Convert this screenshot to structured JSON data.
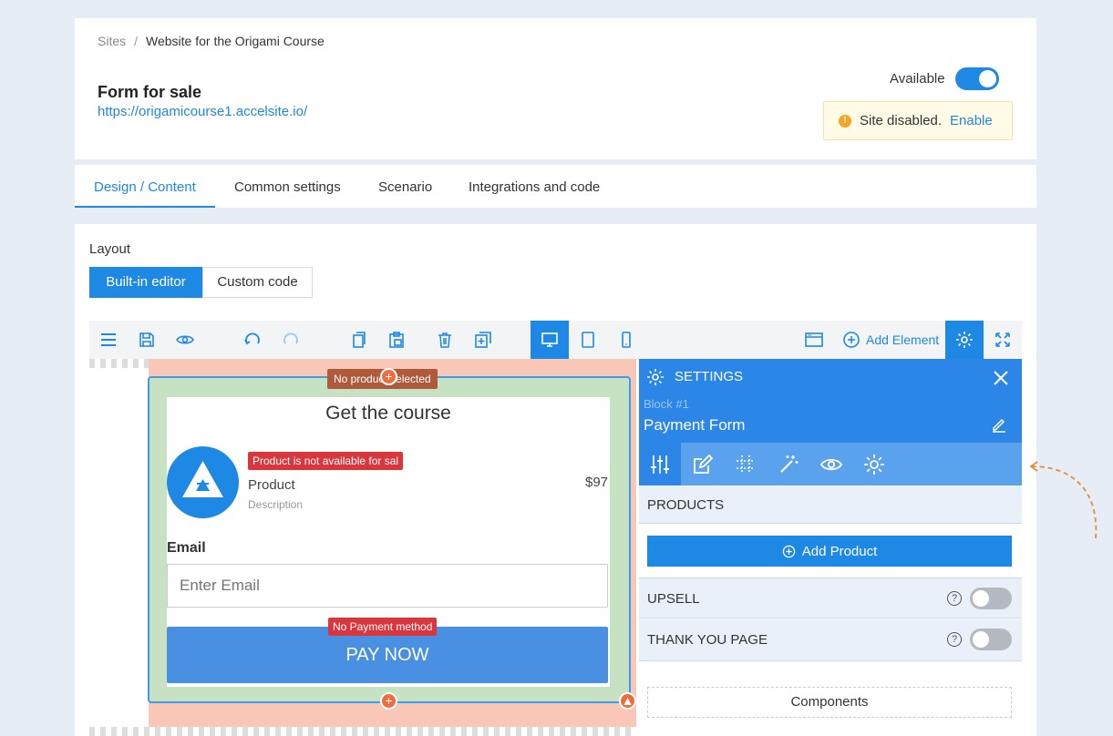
{
  "breadcrumb": {
    "root": "Sites",
    "separator": "/",
    "current": "Website for the Origami Course"
  },
  "site": {
    "title": "Form for sale",
    "url": "https://origamicourse1.accelsite.io/"
  },
  "availability": {
    "label": "Available",
    "enabled": true
  },
  "notice": {
    "text": "Site disabled.",
    "link": "Enable"
  },
  "tabs": [
    {
      "label": "Design / Content",
      "active": true
    },
    {
      "label": "Common settings"
    },
    {
      "label": "Scenario"
    },
    {
      "label": "Integrations and code"
    }
  ],
  "layout": {
    "label": "Layout",
    "builtin": "Built-in editor",
    "custom": "Custom code"
  },
  "toolbar": {
    "add_element": "Add Element"
  },
  "form": {
    "title": "Get the course",
    "no_product_tag": "No product selected",
    "not_available_tag": "Product is not available for sal",
    "product_name": "Product",
    "product_desc": "Description",
    "price": "$97",
    "email_label": "Email",
    "email_placeholder": "Enter Email",
    "no_payment_tag": "No Payment method",
    "pay_button": "PAY NOW"
  },
  "settings": {
    "title": "SETTINGS",
    "block_no": "Block #1",
    "block_name": "Payment Form",
    "products_label": "PRODUCTS",
    "add_product": "Add Product",
    "upsell_label": "UPSELL",
    "thank_you_label": "THANK YOU PAGE",
    "components": "Components"
  },
  "colors": {
    "accent": "#1e88e5",
    "danger": "#d9363e",
    "warning": "#f5a623"
  }
}
